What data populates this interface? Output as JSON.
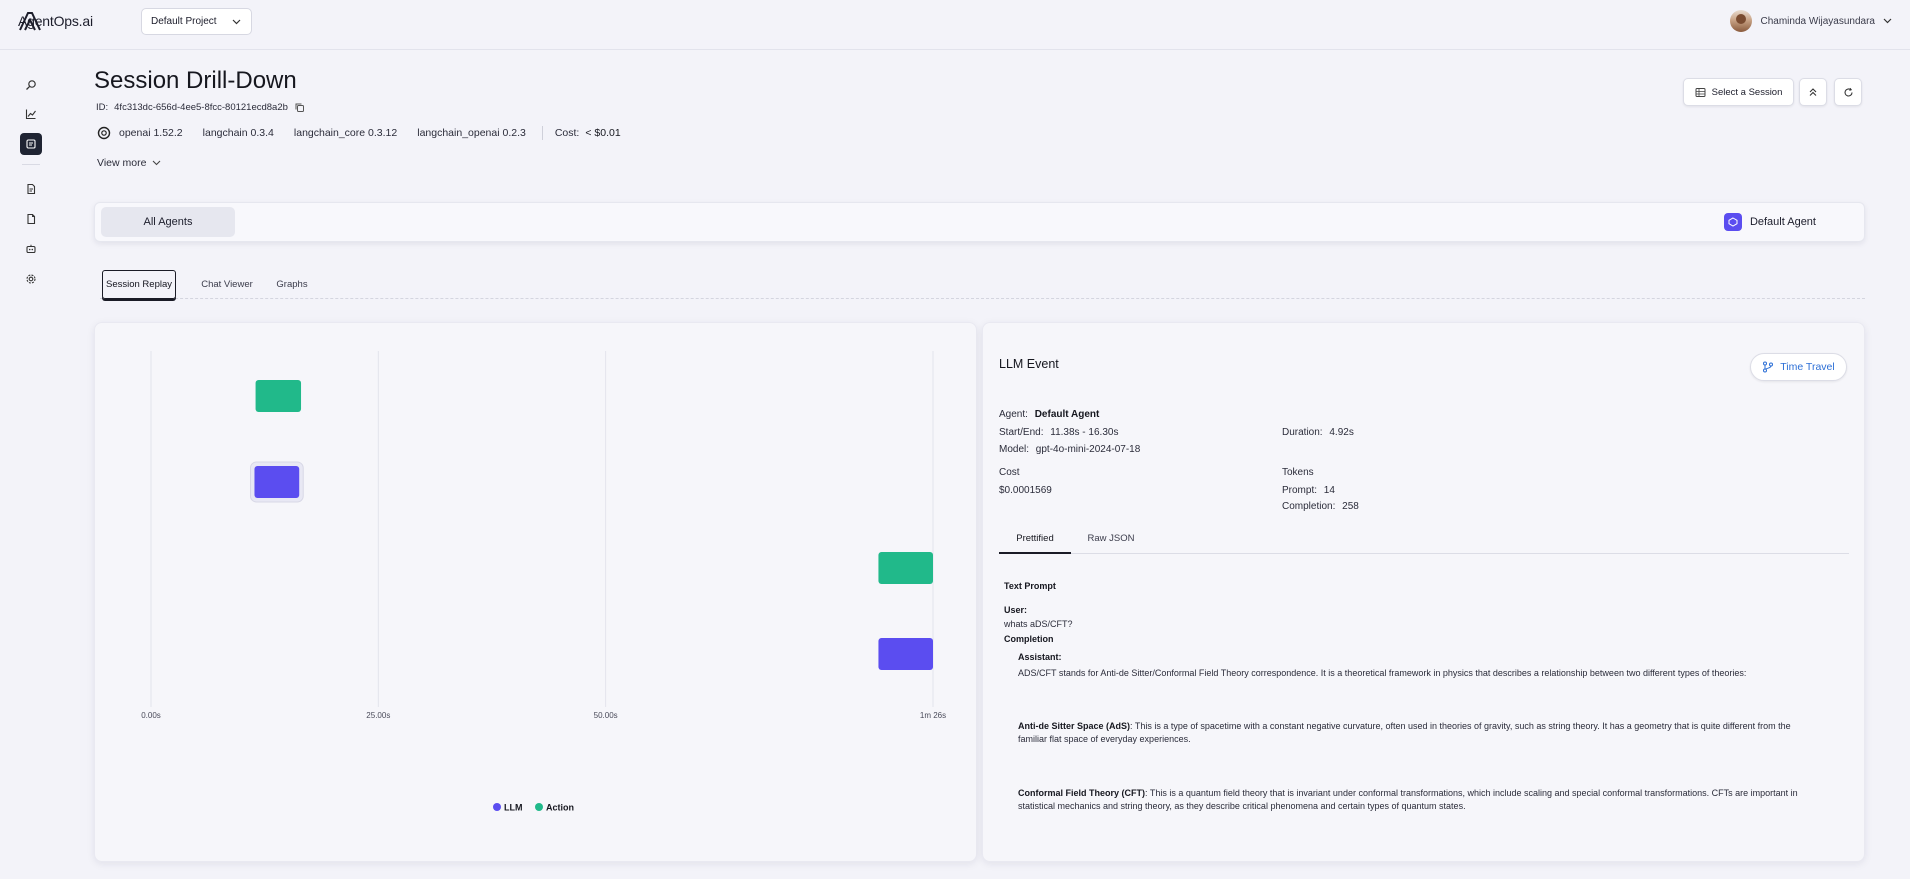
{
  "app": {
    "logo_text": "AgentOps.ai",
    "project": "Default Project",
    "user_name": "Chaminda Wijayasundara"
  },
  "sidebar": {
    "icons": [
      "search-icon",
      "chart-icon",
      "sessions-icon",
      "file-icon",
      "document-icon",
      "robot-icon",
      "settings-icon"
    ],
    "active": "sessions-icon"
  },
  "header": {
    "title": "Session Drill-Down",
    "id_label": "ID:",
    "id_value": "4fc313dc-656d-4ee5-8fcc-80121ecd8a2b",
    "packages": [
      "openai 1.52.2",
      "langchain 0.3.4",
      "langchain_core 0.3.12",
      "langchain_openai 0.2.3"
    ],
    "cost_label": "Cost:",
    "cost_value": "< $0.01",
    "view_more": "View more",
    "select_session": "Select a Session"
  },
  "agents": {
    "all_label": "All Agents",
    "default_label": "Default Agent"
  },
  "tabs": [
    "Session Replay",
    "Chat Viewer",
    "Graphs"
  ],
  "active_tab": "Session Replay",
  "timeline": {
    "ticks": [
      "0.00s",
      "25.00s",
      "50.00s",
      "1m 26s"
    ],
    "legend": [
      {
        "label": "LLM",
        "color": "#5b4df0"
      },
      {
        "label": "Action",
        "color": "#21b98a"
      }
    ],
    "events": [
      {
        "type": "Action",
        "start_s": 11.5,
        "end_s": 16.5,
        "row": 0
      },
      {
        "type": "LLM",
        "start_s": 11.38,
        "end_s": 16.3,
        "row": 1,
        "selected": true
      },
      {
        "type": "Action",
        "start_s": 80.0,
        "end_s": 86.0,
        "row": 2
      },
      {
        "type": "LLM",
        "start_s": 80.0,
        "end_s": 86.0,
        "row": 3
      }
    ],
    "total_s": 86
  },
  "event": {
    "title": "LLM Event",
    "time_travel": "Time Travel",
    "agent_label": "Agent:",
    "agent_value": "Default Agent",
    "startend_label": "Start/End:",
    "startend_value": "11.38s - 16.30s",
    "duration_label": "Duration:",
    "duration_value": "4.92s",
    "model_label": "Model:",
    "model_value": "gpt-4o-mini-2024-07-18",
    "cost_label": "Cost",
    "cost_value": "$0.0001569",
    "tokens_label": "Tokens",
    "prompt_label": "Prompt:",
    "prompt_value": "14",
    "completion_label": "Completion:",
    "completion_value": "258",
    "subtabs": [
      "Prettified",
      "Raw JSON"
    ],
    "text_prompt_heading": "Text Prompt",
    "user_label": "User:",
    "user_text": "whats aDS/CFT?",
    "completion_heading": "Completion",
    "assistant_label": "Assistant:",
    "para1": "ADS/CFT stands for Anti-de Sitter/Conformal Field Theory correspondence. It is a theoretical framework in physics that describes a relationship between two different types of theories:",
    "para2_bold": "Anti-de Sitter Space (AdS)",
    "para2_line1": ": This is a type of spacetime with a constant negative curvature, often used in theories of gravity, such as string theory. It has a geometry that is quite different from the",
    "para2_line2": "familiar flat space of everyday experiences.",
    "para3_bold": "Conformal Field Theory (CFT)",
    "para3_line1": ": This is a quantum field theory that is invariant under conformal transformations, which include scaling and special conformal transformations. CFTs are important in",
    "para3_line2": "statistical mechanics and string theory, as they describe critical phenomena and certain types of quantum states."
  }
}
